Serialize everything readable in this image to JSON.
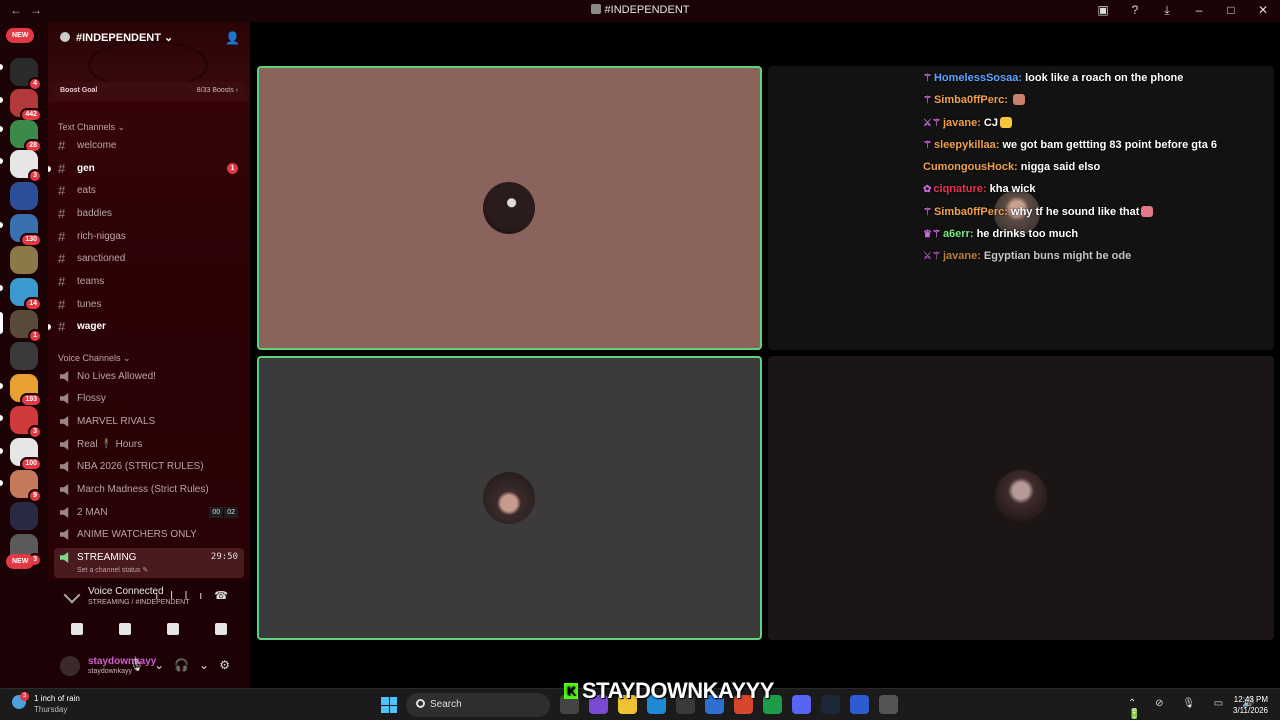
{
  "window": {
    "title": "#INDEPENDENT"
  },
  "server": {
    "name": "#INDEPENDENT",
    "boost_goal": "Boost Goal",
    "boost_count": "8/33 Boosts"
  },
  "rail": {
    "new_top": "NEW",
    "new_bottom": "NEW",
    "badges": [
      "4",
      "442",
      "28",
      "3",
      "130",
      "14",
      "1",
      "193",
      "3",
      "100",
      "9",
      "3"
    ]
  },
  "text_channels": {
    "header": "Text Channels",
    "items": [
      {
        "label": "welcome"
      },
      {
        "label": "gen",
        "mention": "1"
      },
      {
        "label": "eats"
      },
      {
        "label": "baddies"
      },
      {
        "label": "rich-niggas"
      },
      {
        "label": "sanctioned"
      },
      {
        "label": "teams"
      },
      {
        "label": "tunes"
      },
      {
        "label": "wager"
      }
    ]
  },
  "voice_channels": {
    "header": "Voice Channels",
    "items": [
      {
        "label": "No Lives Allowed!"
      },
      {
        "label": "Flossy"
      },
      {
        "label": "MARVEL RIVALS"
      },
      {
        "label": "Real 🕴 Hours"
      },
      {
        "label": "NBA 2026 (STRICT RULES)"
      },
      {
        "label": "March Madness (Strict Rules)"
      },
      {
        "label": "2 MAN",
        "count_a": "00",
        "count_b": "02"
      },
      {
        "label": "ANIME WATCHERS ONLY"
      },
      {
        "label": "STREAMING",
        "time": "29:50",
        "status": "Set a channel status"
      }
    ]
  },
  "voice_panel": {
    "title": "Voice Connected",
    "subtitle": "STREAMING / #INDEPENDENT"
  },
  "user": {
    "display_name": "staydownkayy",
    "username": "staydownkayy"
  },
  "chat": [
    {
      "name": "HomelessSosaa:",
      "text": "look like a roach on the phone",
      "color": "#5ea4ff",
      "badge": "⚚"
    },
    {
      "name": "Simba0ffPerc:",
      "text": "",
      "color": "#f2a14a",
      "badge": "⚚",
      "emote": "#c9826a"
    },
    {
      "name": "javane:",
      "text": "CJ",
      "color": "#f2a14a",
      "badge": "⚔⚚",
      "emote": "#f5c53a"
    },
    {
      "name": "sleepykillaa:",
      "text": "we got bam gettting 83 point before gta 6",
      "color": "#f2a14a",
      "badge": "⚚"
    },
    {
      "name": "CumongousHock:",
      "text": "nigga said elso",
      "color": "#f2a14a",
      "badge": ""
    },
    {
      "name": "ciqnature:",
      "text": "kha wick",
      "color": "#e8334e",
      "badge": "✿"
    },
    {
      "name": "Simba0ffPerc:",
      "text": "why tf he sound like that",
      "color": "#f2a14a",
      "badge": "⚚",
      "emote": "#e07a8a"
    },
    {
      "name": "a6err:",
      "text": "he drinks too much",
      "color": "#7ee87e",
      "badge": "♛⚚"
    },
    {
      "name": "javane:",
      "text": "Egyptian buns might be ode",
      "color": "#f2a14a",
      "badge": "⚔⚚",
      "faded": true
    }
  ],
  "taskbar": {
    "weather_badge": "3",
    "weather": "1 inch of rain",
    "weather_day": "Thursday",
    "search": "Search",
    "time": "12:43 PM",
    "date": "3/11/2026"
  },
  "stream_overlay": {
    "k": "K",
    "text": "STAYDOWNKAYYY"
  },
  "colors": {
    "accent_green": "#5fd27c",
    "sidebar": "#2c0205",
    "mention_red": "#e23a44"
  }
}
